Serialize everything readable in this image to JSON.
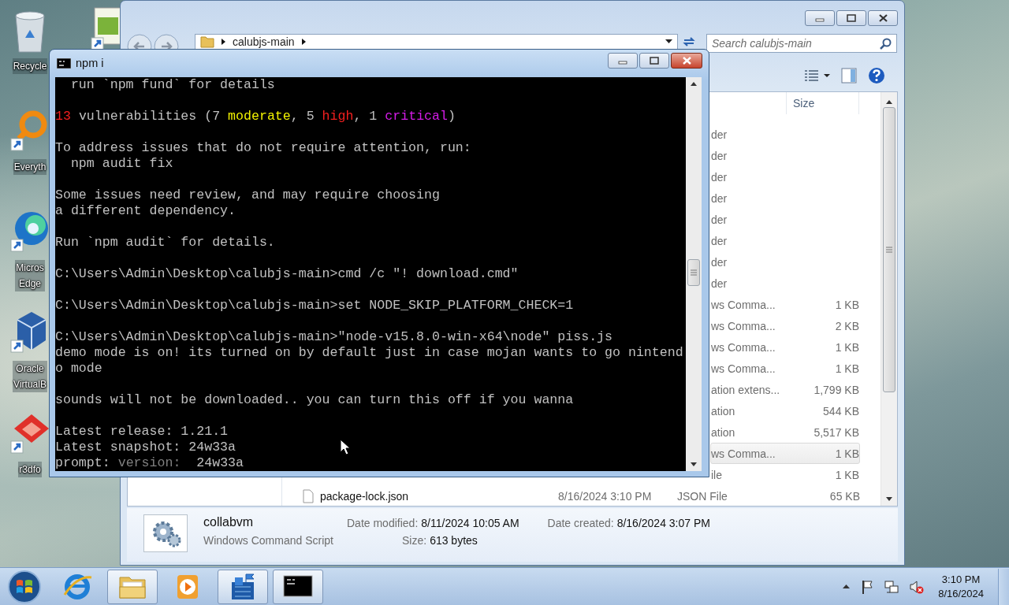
{
  "desktop_icons": [
    {
      "kind": "recycle-bin",
      "label": "Recycle",
      "shortcut": false
    },
    {
      "kind": "magnifier",
      "label": "Everyth",
      "shortcut": true
    },
    {
      "kind": "swirl",
      "label": "Micros\nEdge",
      "shortcut": true
    },
    {
      "kind": "cube",
      "label": "Oracle\nVirtualB",
      "shortcut": true
    },
    {
      "kind": "diamond",
      "label": "r3dfo",
      "shortcut": true
    }
  ],
  "desktop_icons_second_column": [
    {
      "kind": "document",
      "shortcut": true
    }
  ],
  "explorer": {
    "address_segments": [
      "calubjs-main"
    ],
    "search": {
      "placeholder": "Search calubjs-main"
    },
    "columns": [
      "Size"
    ],
    "rows": [
      {
        "type": "der",
        "hovered": false
      },
      {
        "type": "der",
        "hovered": false
      },
      {
        "type": "der",
        "hovered": false
      },
      {
        "type": "der",
        "hovered": false
      },
      {
        "type": "der",
        "hovered": false
      },
      {
        "type": "der",
        "hovered": false
      },
      {
        "type": "der",
        "hovered": false
      },
      {
        "type": "der",
        "hovered": false
      },
      {
        "type": "ws Comma...",
        "size": "1 KB",
        "hovered": false
      },
      {
        "type": "ws Comma...",
        "size": "2 KB",
        "hovered": false
      },
      {
        "type": "ws Comma...",
        "size": "1 KB",
        "hovered": false
      },
      {
        "type": "ws Comma...",
        "size": "1 KB",
        "hovered": false
      },
      {
        "type": "ation extens...",
        "size": "1,799 KB",
        "hovered": false
      },
      {
        "type": "ation",
        "size": "544 KB",
        "hovered": false
      },
      {
        "type": "ation",
        "size": "5,517 KB",
        "hovered": false
      },
      {
        "type": "ws Comma...",
        "size": "1 KB",
        "hovered": true
      },
      {
        "type": "ile",
        "size": "1 KB",
        "hovered": false
      },
      {
        "name": "package-lock.json",
        "date": "8/16/2024 3:10 PM",
        "type": "JSON File",
        "size": "65 KB",
        "hovered": false
      }
    ],
    "details": {
      "name": "collabvm",
      "type": "Windows Command Script",
      "fields": [
        {
          "label": "Date modified:",
          "value": "8/11/2024 10:05 AM"
        },
        {
          "label": "Date created:",
          "value": "8/16/2024 3:07 PM"
        },
        {
          "label": "Size:",
          "value": "613 bytes"
        }
      ]
    }
  },
  "console": {
    "title": "npm i",
    "lines": [
      {
        "kind": "text",
        "segments": [
          {
            "text": "  run `npm fund` for details"
          }
        ]
      },
      {
        "kind": "blank"
      },
      {
        "kind": "text",
        "segments": [
          {
            "text": "13",
            "color": "#f41f1f"
          },
          {
            "text": " vulnerabilities (7 "
          },
          {
            "text": "moderate",
            "color": "#f2f200"
          },
          {
            "text": ", 5 "
          },
          {
            "text": "high",
            "color": "#f41f1f"
          },
          {
            "text": ", 1 "
          },
          {
            "text": "critical",
            "color": "#d51ce8"
          },
          {
            "text": ")"
          }
        ]
      },
      {
        "kind": "blank"
      },
      {
        "kind": "text",
        "segments": [
          {
            "text": "To address issues that do not require attention, run:"
          }
        ]
      },
      {
        "kind": "text",
        "segments": [
          {
            "text": "  npm audit fix"
          }
        ]
      },
      {
        "kind": "blank"
      },
      {
        "kind": "text",
        "segments": [
          {
            "text": "Some issues need review, and may require choosing"
          }
        ]
      },
      {
        "kind": "text",
        "segments": [
          {
            "text": "a different dependency."
          }
        ]
      },
      {
        "kind": "blank"
      },
      {
        "kind": "text",
        "segments": [
          {
            "text": "Run `npm audit` for details."
          }
        ]
      },
      {
        "kind": "blank"
      },
      {
        "kind": "text",
        "segments": [
          {
            "text": "C:\\Users\\Admin\\Desktop\\calubjs-main>cmd /c \"! download.cmd\""
          }
        ]
      },
      {
        "kind": "blank"
      },
      {
        "kind": "text",
        "segments": [
          {
            "text": "C:\\Users\\Admin\\Desktop\\calubjs-main>set NODE_SKIP_PLATFORM_CHECK=1"
          }
        ]
      },
      {
        "kind": "blank"
      },
      {
        "kind": "text",
        "segments": [
          {
            "text": "C:\\Users\\Admin\\Desktop\\calubjs-main>\"node-v15.8.0-win-x64\\node\" piss.js"
          }
        ]
      },
      {
        "kind": "text",
        "segments": [
          {
            "text": "demo mode is on! its turned on by default just in case mojan wants to go nintend"
          }
        ]
      },
      {
        "kind": "text",
        "segments": [
          {
            "text": "o mode"
          }
        ]
      },
      {
        "kind": "blank"
      },
      {
        "kind": "text",
        "segments": [
          {
            "text": "sounds will not be downloaded.. you can turn this off if you wanna"
          }
        ]
      },
      {
        "kind": "blank"
      },
      {
        "kind": "text",
        "segments": [
          {
            "text": "Latest release: 1.21.1"
          }
        ]
      },
      {
        "kind": "text",
        "segments": [
          {
            "text": "Latest snapshot: 24w33a"
          }
        ]
      },
      {
        "kind": "text",
        "segments": [
          {
            "text": "prompt: "
          },
          {
            "text": "version:",
            "color": "#808080"
          },
          {
            "text": "  24w33a"
          }
        ]
      }
    ]
  },
  "taskbar": {
    "buttons": [
      {
        "kind": "browser",
        "running": false
      },
      {
        "kind": "folder",
        "running": true
      },
      {
        "kind": "media",
        "running": false
      },
      {
        "kind": "blocks",
        "running": true
      },
      {
        "kind": "console",
        "running": true
      }
    ],
    "volume_muted": true,
    "clock": {
      "time": "3:10 PM",
      "date": "8/16/2024"
    }
  }
}
